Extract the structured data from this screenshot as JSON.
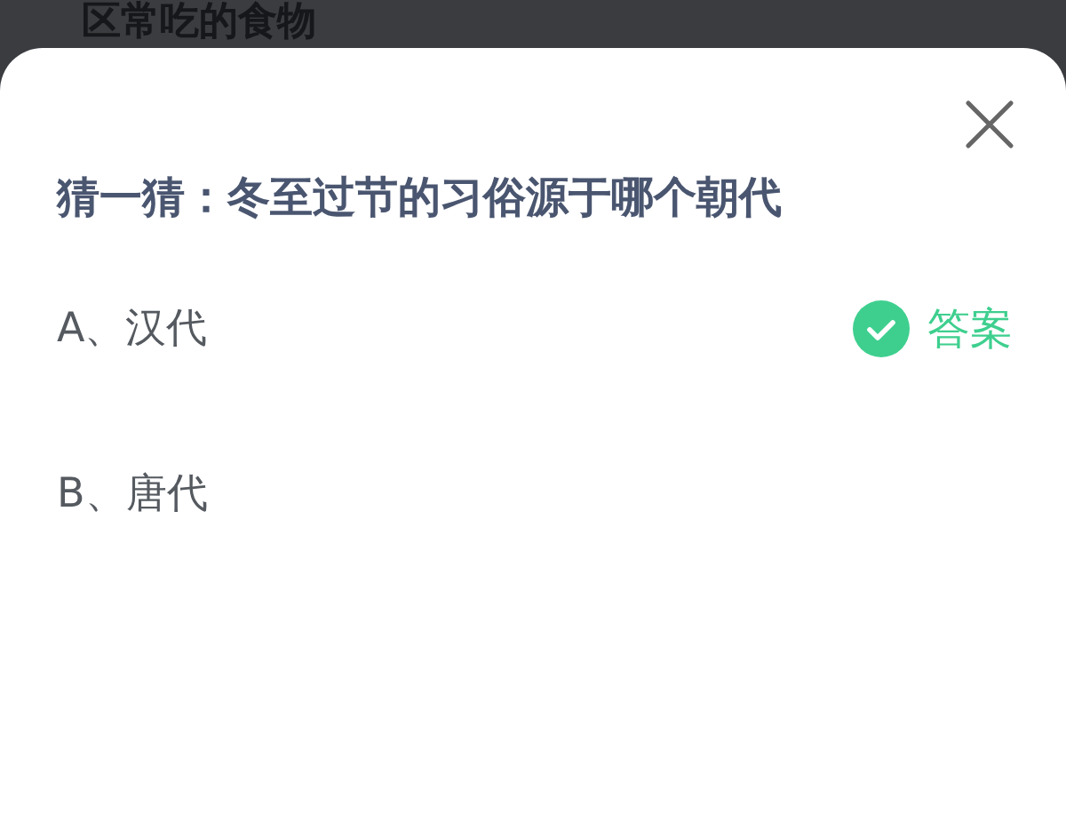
{
  "background": {
    "heading": "区常吃的食物"
  },
  "dialog": {
    "question": "猜一猜：冬至过节的习俗源于哪个朝代",
    "answer_label": "答案",
    "options": [
      {
        "label": "A、汉代",
        "correct": true
      },
      {
        "label": "B、唐代",
        "correct": false
      }
    ]
  }
}
